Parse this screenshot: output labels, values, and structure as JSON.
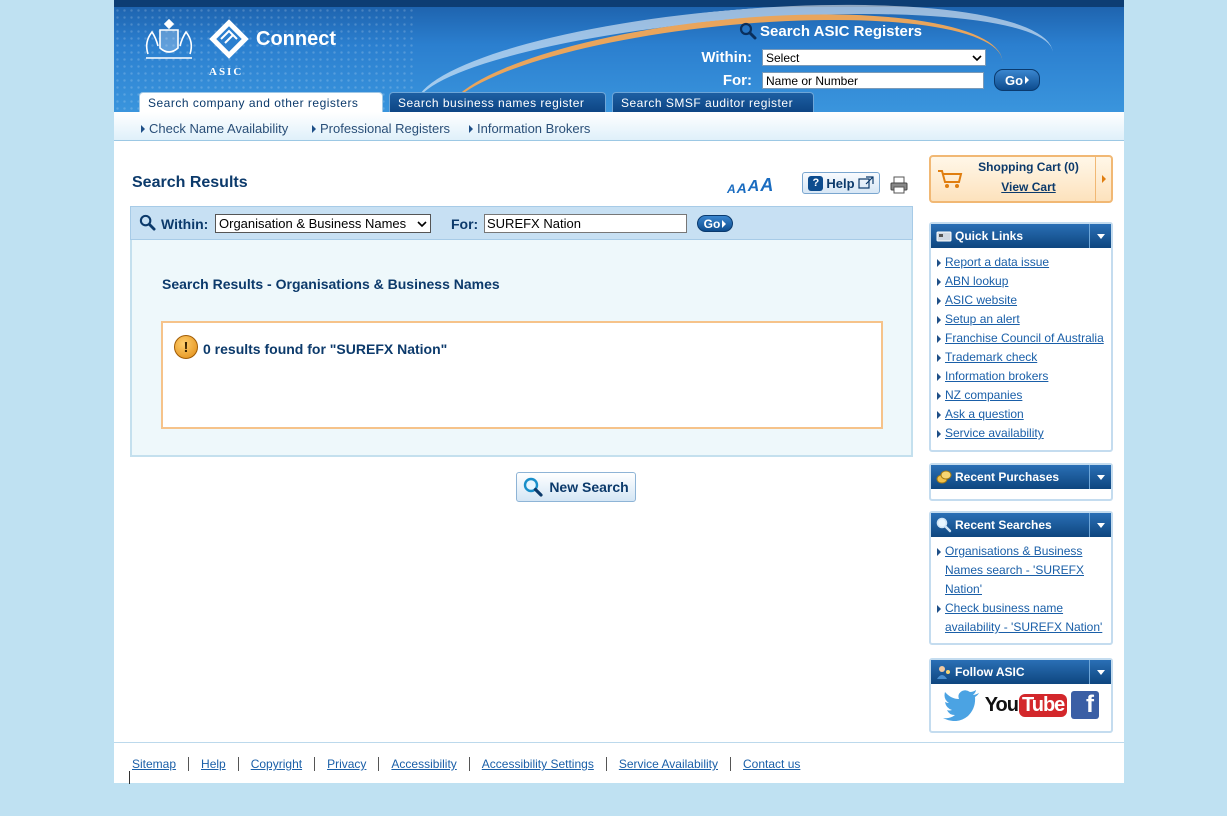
{
  "header": {
    "brand_text": "ASIC",
    "app_name": "Connect",
    "search_title": "Search ASIC Registers",
    "within_label": "Within:",
    "within_value": "Select",
    "for_label": "For:",
    "for_placeholder": "Name or Number",
    "go_label": "Go"
  },
  "tabs": [
    {
      "label": "Search company and other registers",
      "active": true
    },
    {
      "label": "Search business names register",
      "active": false
    },
    {
      "label": "Search SMSF auditor register",
      "active": false
    }
  ],
  "subnav": [
    "Check Name Availability",
    "Professional Registers",
    "Information Brokers"
  ],
  "main": {
    "title": "Search Results",
    "help_label": "Help",
    "search_bar": {
      "within_label": "Within:",
      "within_value": "Organisation & Business Names",
      "for_label": "For:",
      "for_value": "SUREFX Nation",
      "go_label": "Go"
    },
    "results_title": "Search Results - Organisations & Business Names",
    "results_message": "0 results found for \"SUREFX Nation\"",
    "new_search_label": "New Search"
  },
  "sidebar": {
    "cart": {
      "title": "Shopping Cart (0)",
      "link": "View Cart"
    },
    "quick_links": {
      "title": "Quick Links",
      "items": [
        "Report a data issue",
        "ABN lookup",
        "ASIC website",
        "Setup an alert",
        "Franchise Council of Australia",
        "Trademark check",
        "Information brokers",
        "NZ companies",
        "Ask a question",
        "Service availability"
      ]
    },
    "recent_purchases": {
      "title": "Recent Purchases"
    },
    "recent_searches": {
      "title": "Recent Searches",
      "items": [
        "Organisations & Business Names search - 'SUREFX Nation'",
        "Check business name availability - 'SUREFX Nation'"
      ]
    },
    "follow": {
      "title": "Follow ASIC",
      "youtube_you": "You",
      "youtube_tube": "Tube",
      "facebook": "f"
    }
  },
  "footer": {
    "links": [
      "Sitemap",
      "Help",
      "Copyright",
      "Privacy",
      "Accessibility",
      "Accessibility Settings",
      "Service Availability",
      "Contact us"
    ]
  },
  "colors": {
    "brand_blue": "#0c3a6b",
    "accent_orange": "#f1b874",
    "page_bg": "#bfe1f2"
  }
}
